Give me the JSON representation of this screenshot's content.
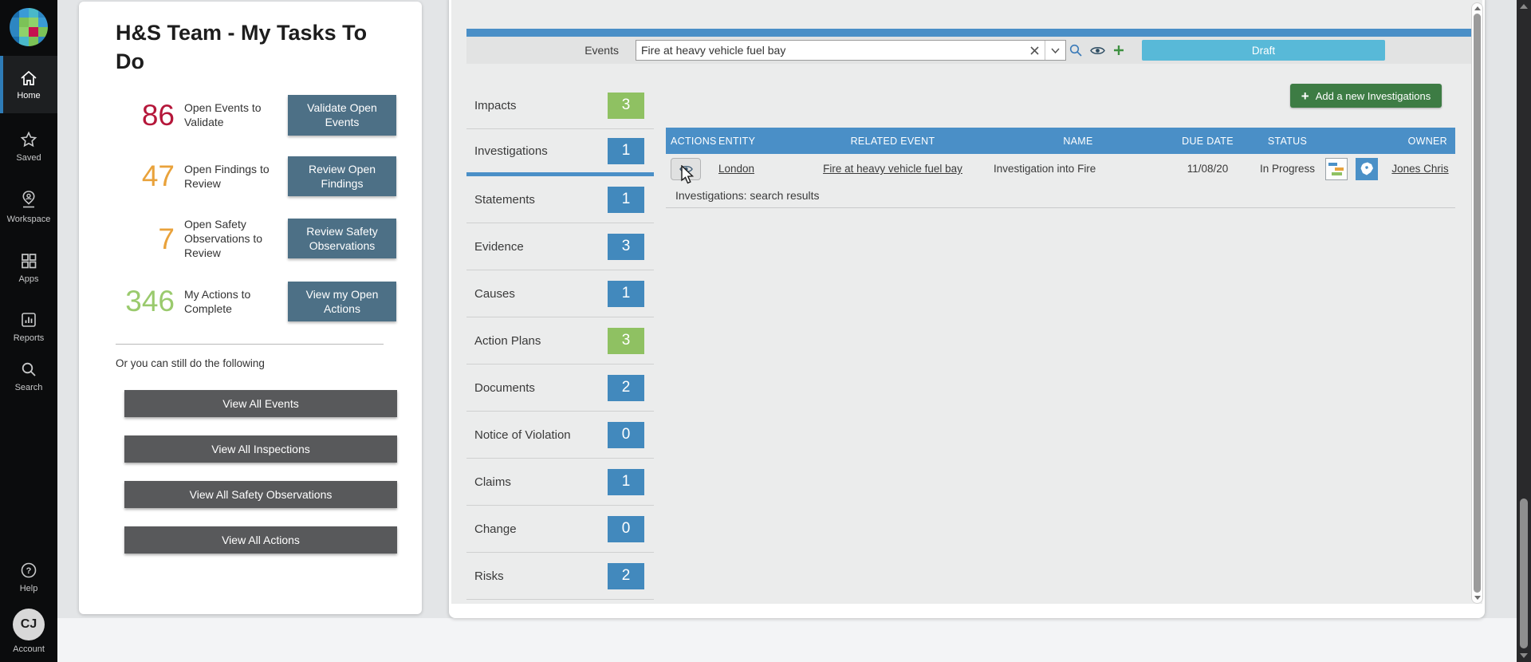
{
  "sidebar": {
    "items": [
      {
        "label": "Home",
        "icon": "home-icon",
        "active": true
      },
      {
        "label": "Saved",
        "icon": "star-icon",
        "active": false
      },
      {
        "label": "Workspace",
        "icon": "map-pin-icon",
        "active": false
      },
      {
        "label": "Apps",
        "icon": "grid-icon",
        "active": false
      },
      {
        "label": "Reports",
        "icon": "bar-chart-icon",
        "active": false
      },
      {
        "label": "Search",
        "icon": "search-icon",
        "active": false
      }
    ],
    "help_label": "Help",
    "account_label": "Account",
    "account_initials": "CJ"
  },
  "tasks_card": {
    "title": "H&S Team - My Tasks To Do",
    "stats": [
      {
        "count": "86",
        "label": "Open Events to Validate",
        "button": "Validate Open Events",
        "count_color": "#b5173a"
      },
      {
        "count": "47",
        "label": "Open Findings to Review",
        "button": "Review Open Findings",
        "count_color": "#e9a23b"
      },
      {
        "count": "7",
        "label": "Open Safety Observations to Review",
        "button": "Review Safety Observations",
        "count_color": "#e9a23b"
      },
      {
        "count": "346",
        "label": "My Actions to Complete",
        "button": "View my Open Actions",
        "count_color": "#9aca6d"
      }
    ],
    "or_text": "Or you can still do the following",
    "view_all_buttons": [
      "View All Events",
      "View All Inspections",
      "View All Safety Observations",
      "View All Actions"
    ]
  },
  "event_panel": {
    "events_label": "Events",
    "event_value": "Fire at heavy vehicle fuel bay",
    "status_badge": "Draft",
    "subnav": [
      {
        "label": "Impacts",
        "count": "3",
        "badge_color": "#8fc162",
        "active": false
      },
      {
        "label": "Investigations",
        "count": "1",
        "badge_color": "#4289bd",
        "active": true
      },
      {
        "label": "Statements",
        "count": "1",
        "badge_color": "#4289bd",
        "active": false
      },
      {
        "label": "Evidence",
        "count": "3",
        "badge_color": "#4289bd",
        "active": false
      },
      {
        "label": "Causes",
        "count": "1",
        "badge_color": "#4289bd",
        "active": false
      },
      {
        "label": "Action Plans",
        "count": "3",
        "badge_color": "#8fc162",
        "active": false
      },
      {
        "label": "Documents",
        "count": "2",
        "badge_color": "#4289bd",
        "active": false
      },
      {
        "label": "Notice of Violation",
        "count": "0",
        "badge_color": "#4289bd",
        "active": false
      },
      {
        "label": "Claims",
        "count": "1",
        "badge_color": "#4289bd",
        "active": false
      },
      {
        "label": "Change",
        "count": "0",
        "badge_color": "#4289bd",
        "active": false
      },
      {
        "label": "Risks",
        "count": "2",
        "badge_color": "#4289bd",
        "active": false
      }
    ],
    "add_button": {
      "plus": "+",
      "label": "Add a new Investigations"
    },
    "table": {
      "headers": [
        "ACTIONS",
        "ENTITY",
        "RELATED EVENT",
        "NAME",
        "DUE DATE",
        "STATUS",
        "OWNER"
      ],
      "row": {
        "entity": "London",
        "related_event": "Fire at heavy vehicle fuel bay",
        "name": "Investigation into Fire",
        "due_date": "11/08/20",
        "status": "In Progress",
        "owner": "Jones Chris",
        "action_icon": "eye-icon",
        "extra_icons": [
          "gantt-chart-icon",
          "map-location-icon"
        ]
      },
      "caption": "Investigations: search results"
    }
  },
  "colors": {
    "accent_blue": "#4a8fc7",
    "badge_blue": "#4289bd",
    "badge_green": "#8fc162",
    "draft_badge_blue": "#58b9d8",
    "add_button_green": "#3d7c44",
    "stat_button_slate": "#4d7086",
    "view_all_gray": "#58595b",
    "sidebar_black": "#0b0c0d",
    "count_red": "#b5173a",
    "count_orange": "#e9a23b",
    "count_green": "#9aca6d"
  }
}
